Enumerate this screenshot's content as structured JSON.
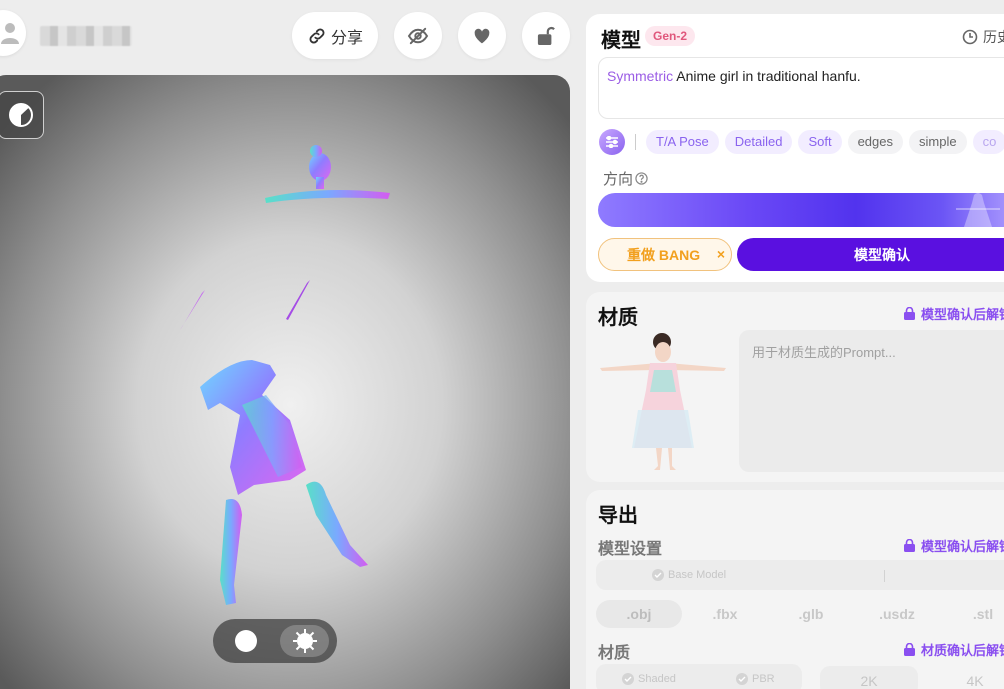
{
  "header": {
    "share_label": "分享",
    "icons": [
      "user-icon",
      "link-icon",
      "eye-off-icon",
      "heart-icon",
      "unlock-icon"
    ]
  },
  "model_panel": {
    "title": "模型",
    "badge": "Gen-2",
    "history_label": "历史",
    "prompt": {
      "keyword": "Symmetric",
      "text": " Anime girl in traditional hanfu."
    },
    "chips": [
      "T/A Pose",
      "Detailed",
      "Soft",
      "edges",
      "simple",
      "co"
    ],
    "direction_label": "方向",
    "redo_label": "重做 BANG",
    "redo_close": "×",
    "confirm_label": "模型确认"
  },
  "material_panel": {
    "title": "材质",
    "locked_label": "模型确认后解锁",
    "prompt_placeholder": "用于材质生成的Prompt..."
  },
  "export_panel": {
    "title": "导出",
    "model_settings_label": "模型设置",
    "model_locked_label": "模型确认后解锁",
    "base_model_label": "Base Model",
    "formats": [
      ".obj",
      ".fbx",
      ".glb",
      ".usdz",
      ".stl"
    ],
    "material_label": "材质",
    "material_locked_label": "材质确认后解锁",
    "material_options": [
      "Shaded",
      "PBR"
    ],
    "resolutions": [
      "2K",
      "4K"
    ]
  },
  "colors": {
    "accent_purple": "#5a10e0",
    "badge_pink": "#e0577c",
    "redo_orange": "#f2a01e",
    "locked_purple": "#8a4ff0"
  }
}
